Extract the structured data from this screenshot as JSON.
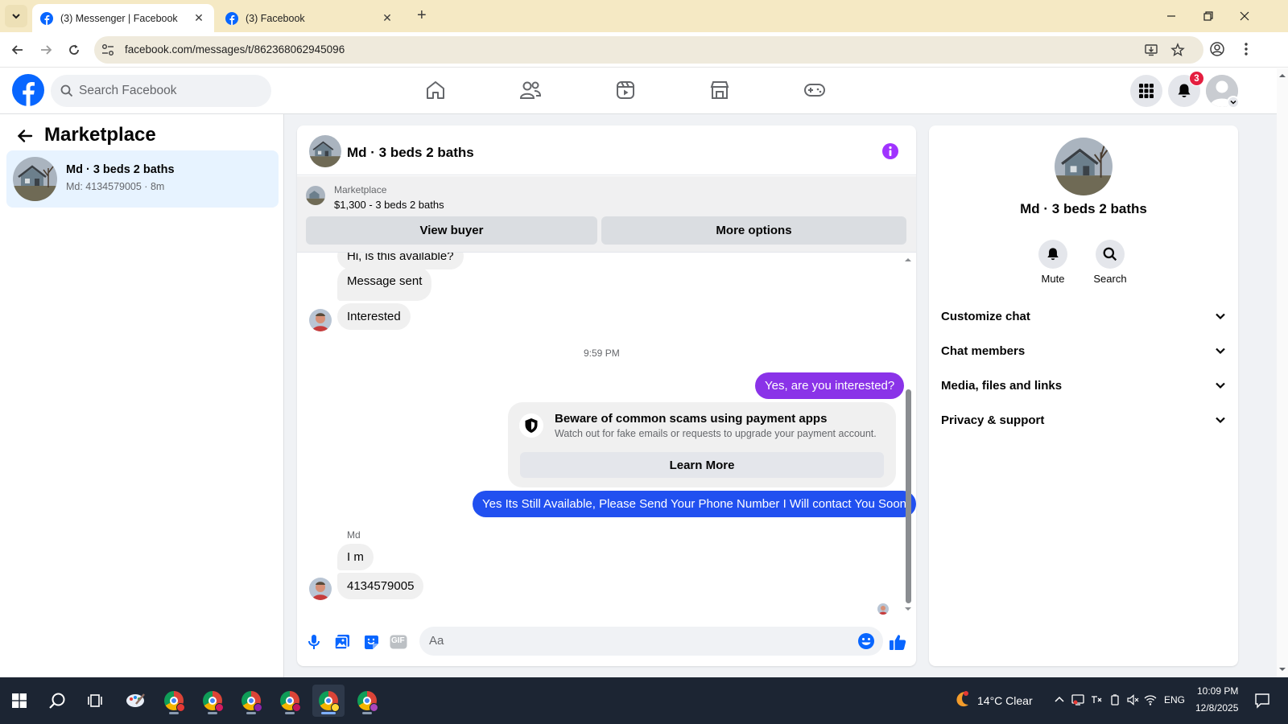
{
  "browser": {
    "tabs": [
      {
        "title": "(3) Messenger | Facebook",
        "active": true
      },
      {
        "title": "(3) Facebook",
        "active": false
      }
    ],
    "new_tab_label": "+",
    "url": "facebook.com/messages/t/862368062945096"
  },
  "fb": {
    "search_placeholder": "Search Facebook",
    "notification_count": "3",
    "brand_color": "#0866ff"
  },
  "left": {
    "title": "Marketplace",
    "conversation": {
      "name": "Md · 3 beds 2 baths",
      "sub": "Md: 4134579005 · 8m"
    }
  },
  "chat": {
    "title": "Md · 3 beds 2 baths",
    "listing_label": "Marketplace",
    "listing_price": "$1,300 - 3 beds 2 baths",
    "view_buyer": "View buyer",
    "more_options": "More options",
    "partial_message": "Hi, is this available?",
    "messages": [
      {
        "from": "them",
        "text": "Message sent"
      },
      {
        "from": "them",
        "text": "Interested"
      },
      {
        "from": "me",
        "text": "Yes, are you interested?"
      },
      {
        "from": "me",
        "text": "Yes Its Still Available, Please Send Your Phone Number I Will contact You Soon"
      },
      {
        "from": "them",
        "text": "I m"
      },
      {
        "from": "them",
        "text": "4134579005"
      }
    ],
    "timestamp": "9:59 PM",
    "sender_name": "Md",
    "scam_notice": {
      "title": "Beware of common scams using payment apps",
      "body": "Watch out for fake emails or requests to upgrade your payment account.",
      "button": "Learn More"
    },
    "composer_placeholder": "Aa",
    "gif_label": "GIF"
  },
  "right": {
    "title": "Md · 3 beds 2 baths",
    "actions": [
      {
        "label": "Mute",
        "icon": "bell-icon"
      },
      {
        "label": "Search",
        "icon": "search-icon"
      }
    ],
    "sections": [
      {
        "label": "Customize chat"
      },
      {
        "label": "Chat members"
      },
      {
        "label": "Media, files and links"
      },
      {
        "label": "Privacy & support"
      }
    ]
  },
  "taskbar": {
    "weather": "14°C  Clear",
    "language": "ENG",
    "time": "10:09 PM",
    "date": "12/8/2025"
  }
}
